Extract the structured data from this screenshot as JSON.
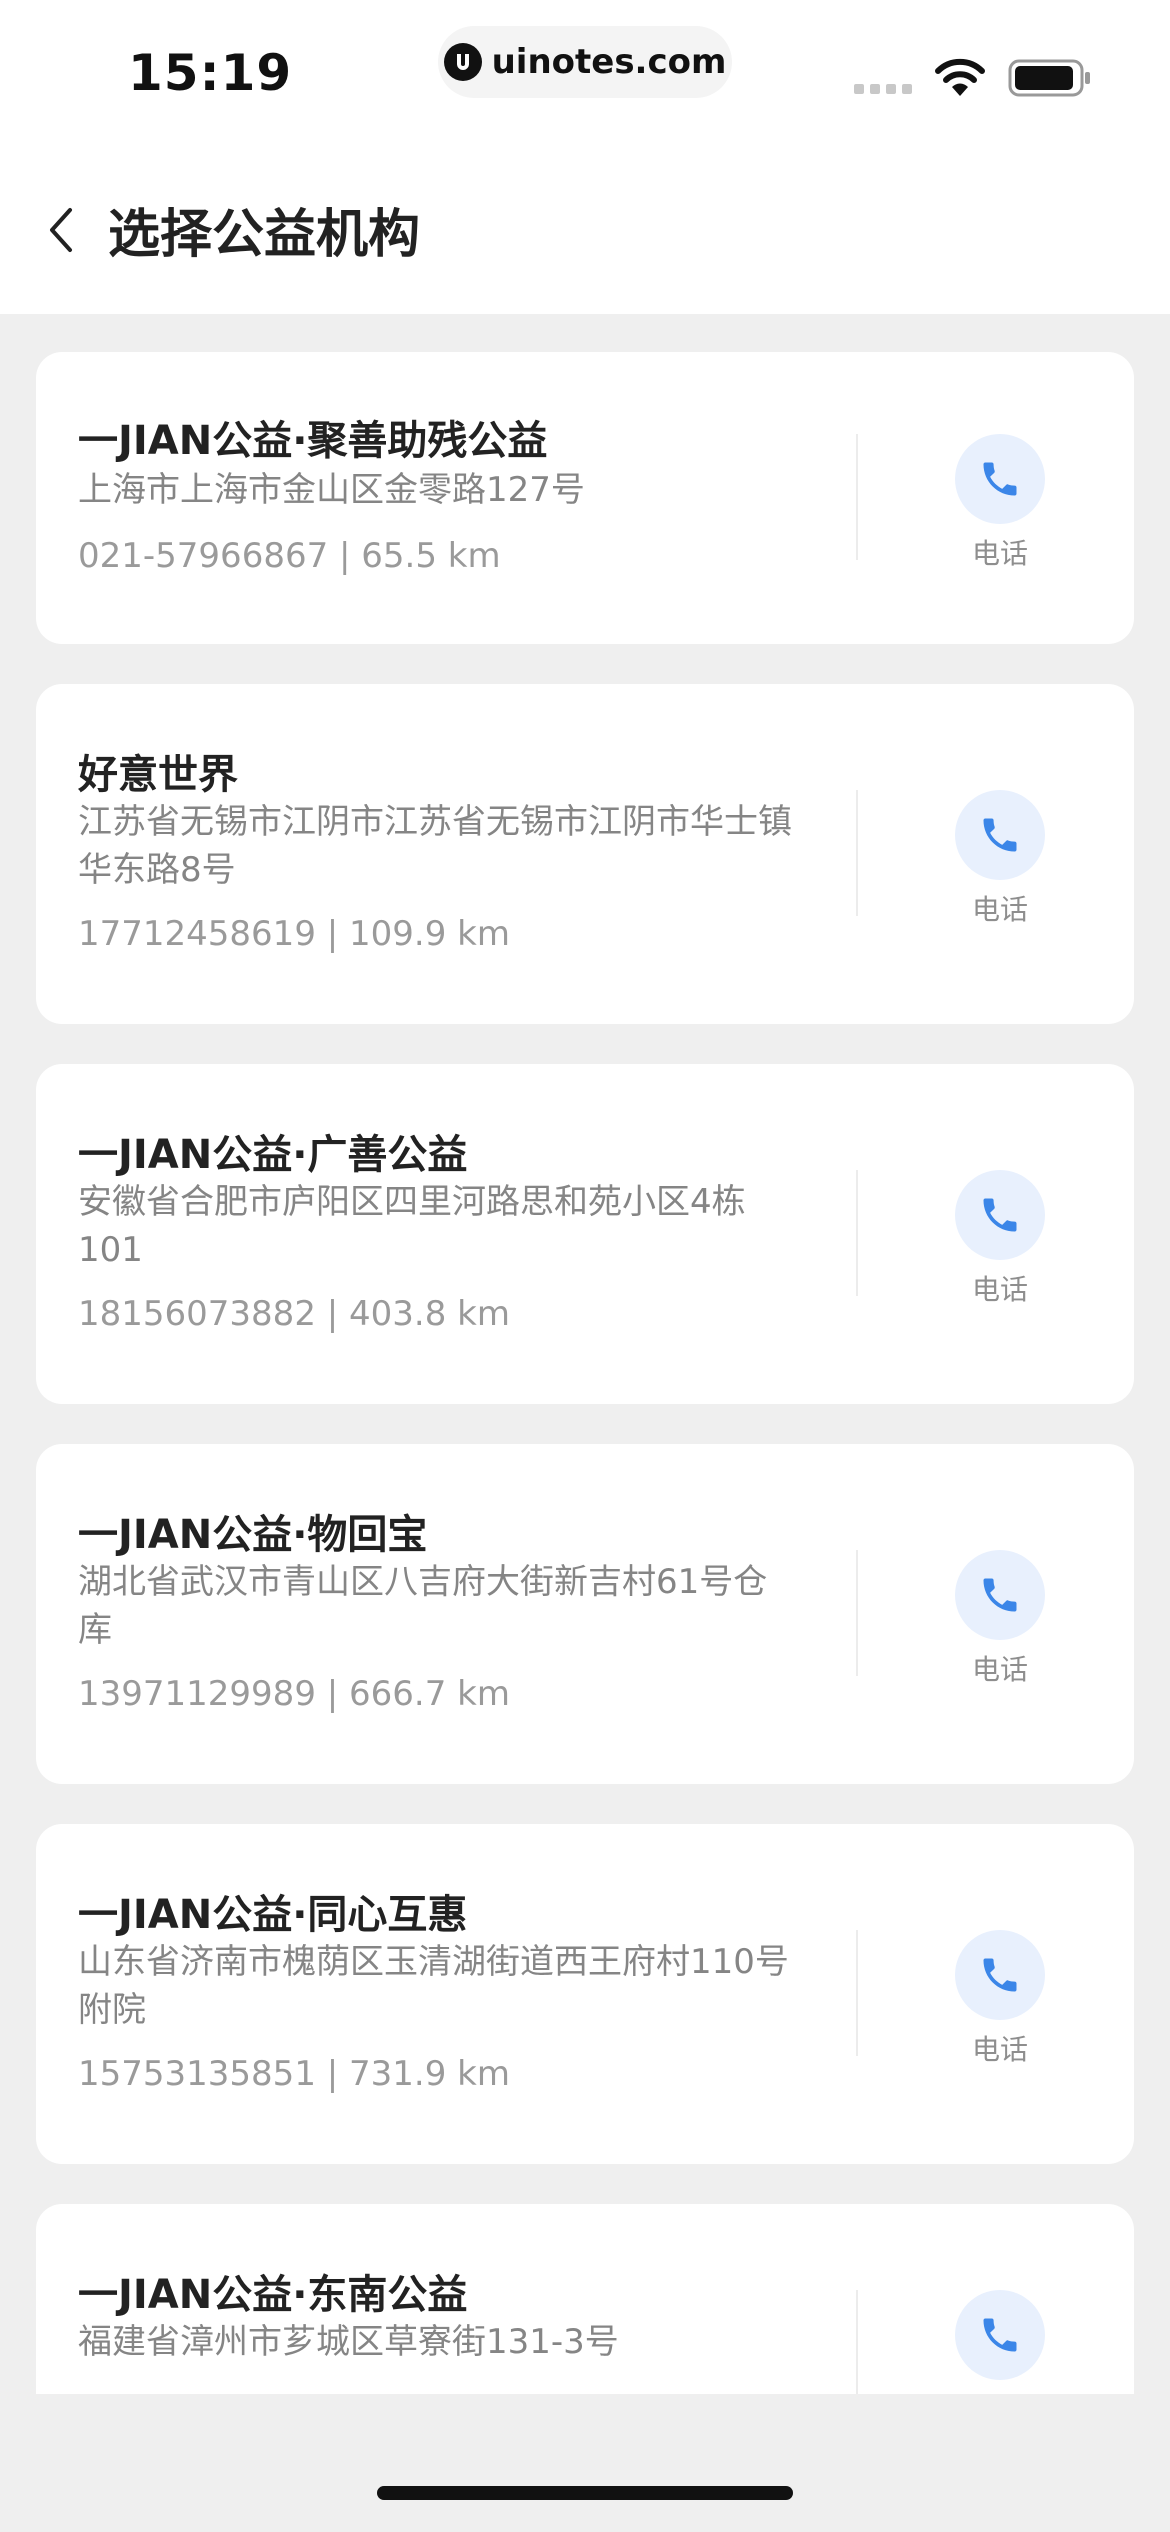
{
  "status_bar": {
    "time": "15:19",
    "url": "uinotes.com",
    "icons": [
      "signal-icon",
      "wifi-icon",
      "battery-icon"
    ]
  },
  "nav": {
    "title": "选择公益机构",
    "back_icon": "chevron-left-icon"
  },
  "call_label": "电话",
  "accent_color": "#3b86e8",
  "organizations": [
    {
      "name": "一JIAN公益·聚善助残公益",
      "address": "上海市上海市金山区金零路127号",
      "meta": "021-57966867 | 65.5 km"
    },
    {
      "name": "好意世界",
      "address": "江苏省无锡市江阴市江苏省无锡市江阴市华士镇华东路8号",
      "meta": "17712458619 | 109.9 km"
    },
    {
      "name": "一JIAN公益·广善公益",
      "address": "安徽省合肥市庐阳区四里河路思和苑小区4栋101",
      "meta": "18156073882 | 403.8 km"
    },
    {
      "name": "一JIAN公益·物回宝",
      "address": "湖北省武汉市青山区八吉府大街新吉村61号仓库",
      "meta": "13971129989 | 666.7 km"
    },
    {
      "name": "一JIAN公益·同心互惠",
      "address": "山东省济南市槐荫区玉清湖街道西王府村110号附院",
      "meta": "15753135851 | 731.9 km"
    },
    {
      "name": "一JIAN公益·东南公益",
      "address": "福建省漳州市芗城区草寮街131-3号",
      "meta": ""
    }
  ]
}
